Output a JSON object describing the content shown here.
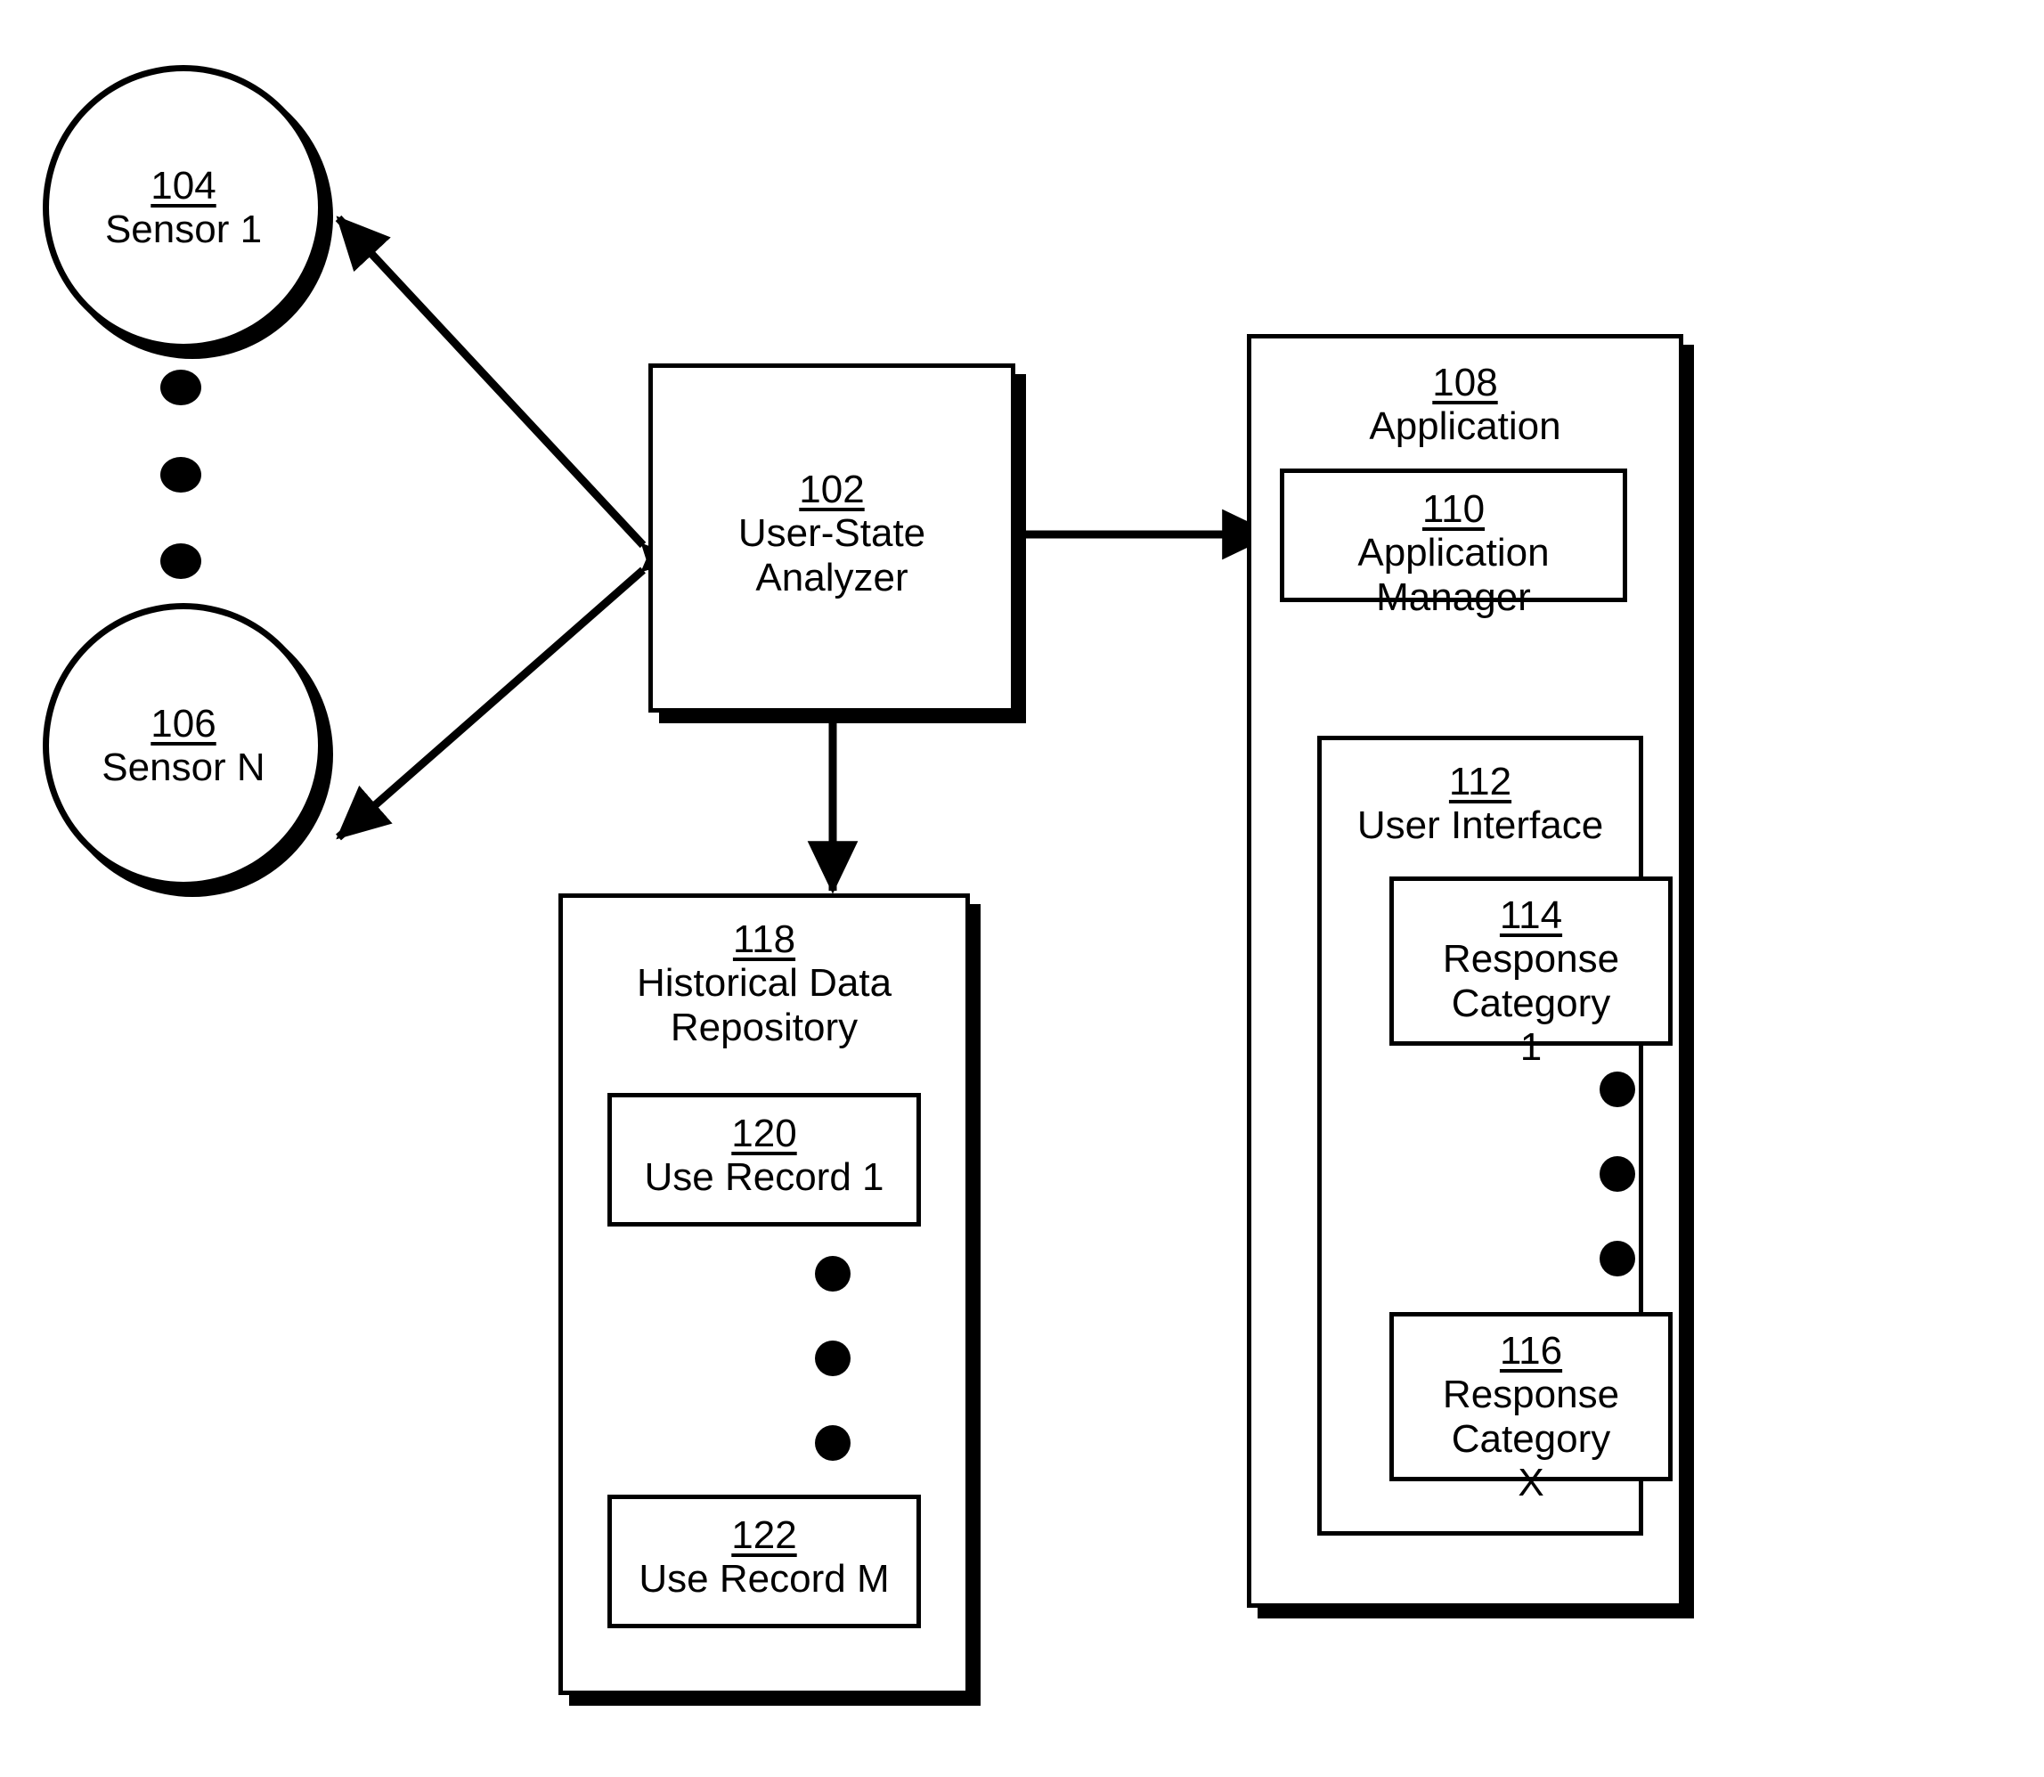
{
  "figure": {
    "type": "patent-block-diagram",
    "background": "#ffffff",
    "stroke": "#000000"
  },
  "nodes": {
    "sensor_1": {
      "ref": "104",
      "name": "Sensor 1",
      "shape": "circle"
    },
    "sensor_n": {
      "ref": "106",
      "name": "Sensor N",
      "shape": "circle"
    },
    "analyzer": {
      "ref": "102",
      "name": "User-State\nAnalyzer",
      "shape": "box"
    },
    "application": {
      "ref": "108",
      "name": "Application",
      "shape": "box"
    },
    "app_manager": {
      "ref": "110",
      "name": "Application Manager",
      "shape": "box"
    },
    "user_interface": {
      "ref": "112",
      "name": "User Interface",
      "shape": "box"
    },
    "response_category_1": {
      "ref": "114",
      "name": "Response Category\n1",
      "shape": "box"
    },
    "response_category_x": {
      "ref": "116",
      "name": "Response Category\nX",
      "shape": "box"
    },
    "repository": {
      "ref": "118",
      "name": "Historical Data\nRepository",
      "shape": "box"
    },
    "use_record_1": {
      "ref": "120",
      "name": "Use Record 1",
      "shape": "box"
    },
    "use_record_m": {
      "ref": "122",
      "name": "Use Record M",
      "shape": "box"
    }
  },
  "ellipses": {
    "sensor_列": {
      "count": 3,
      "orientation": "vertical"
    },
    "records": {
      "count": 3,
      "orientation": "vertical"
    },
    "categories": {
      "count": 3,
      "orientation": "vertical"
    }
  },
  "connections": [
    {
      "from": "analyzer",
      "to": "sensor_1",
      "style": "double-arrow"
    },
    {
      "from": "analyzer",
      "to": "sensor_n",
      "style": "double-arrow"
    },
    {
      "from": "analyzer",
      "to": "app_manager",
      "style": "double-arrow"
    },
    {
      "from": "analyzer",
      "to": "repository",
      "style": "double-arrow"
    },
    {
      "from": "app_manager",
      "to": "user_interface",
      "style": "double-arrow"
    }
  ]
}
